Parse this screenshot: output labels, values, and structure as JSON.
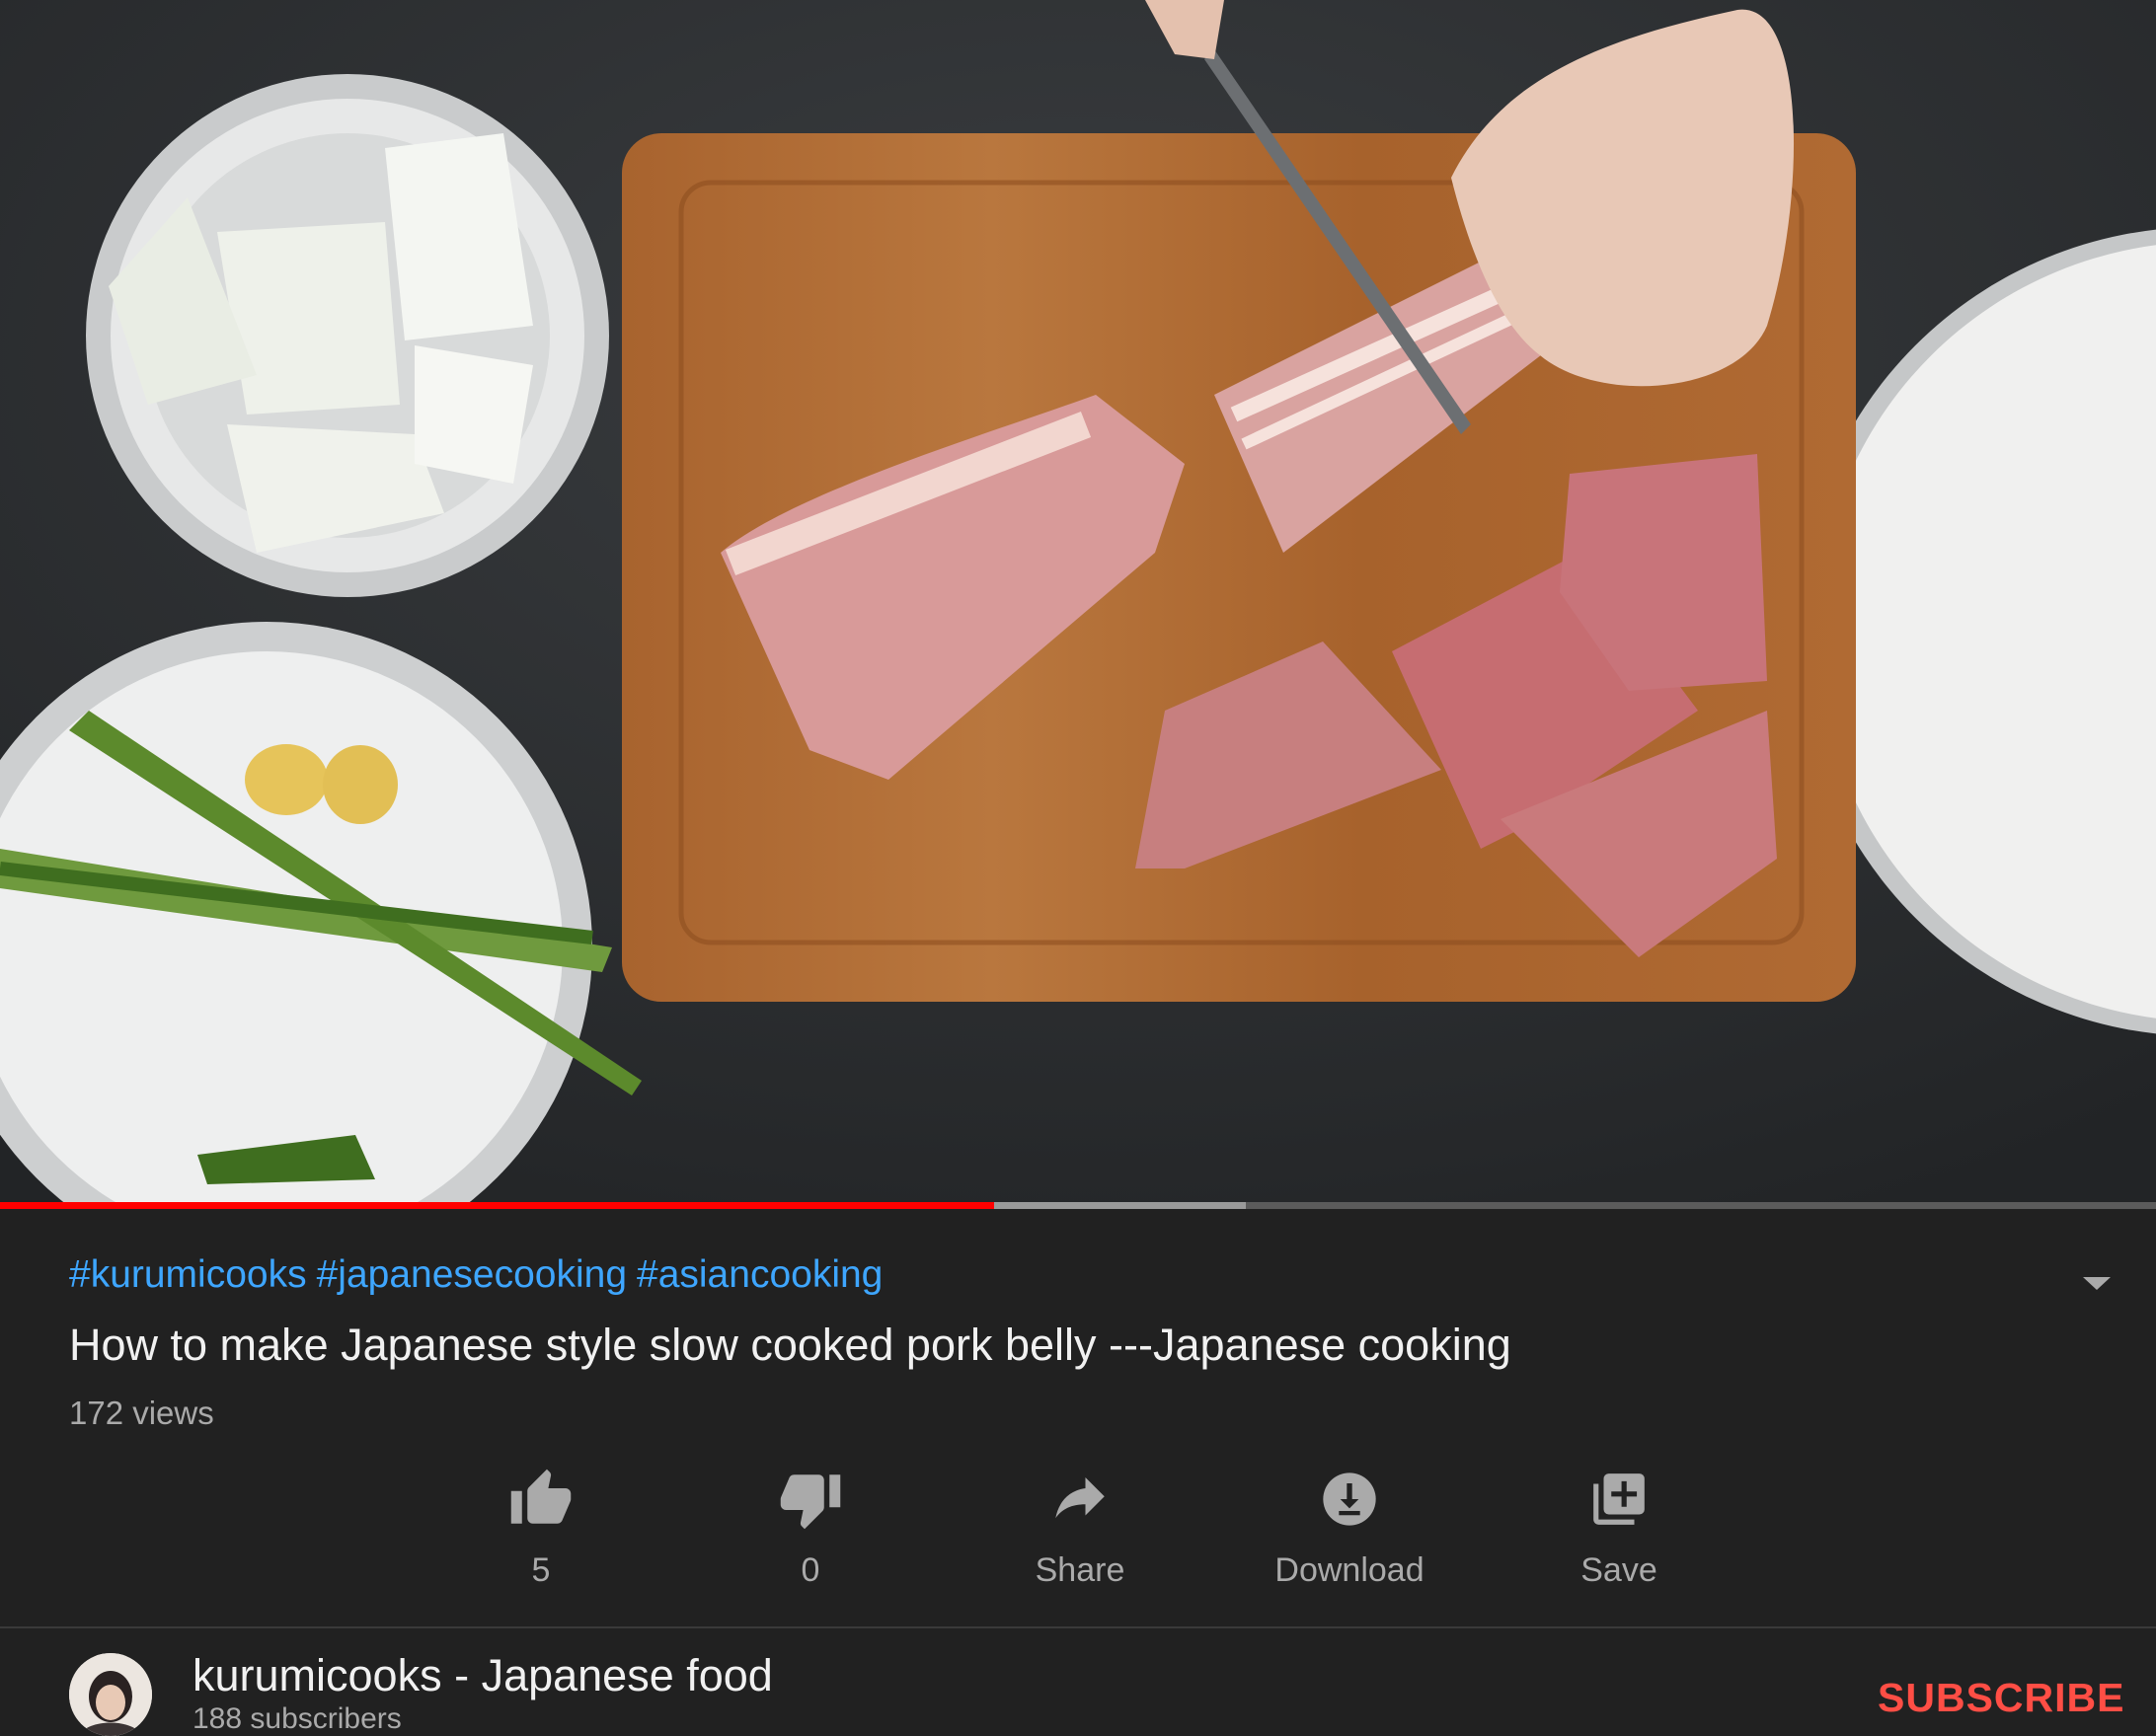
{
  "video": {
    "scene": "overhead-cutting-board-pork-belly",
    "progress_played": 0.461,
    "progress_buffered": 0.578
  },
  "description": {
    "hashtags": [
      "#kurumicooks",
      "#japanesecooking",
      "#asiancooking"
    ],
    "title": "How to make Japanese style slow cooked pork belly ---Japanese cooking",
    "views": "172 views",
    "expand_icon": "chevron-down-icon"
  },
  "actions": [
    {
      "key": "like",
      "label": "5",
      "icon": "thumbs-up-icon"
    },
    {
      "key": "dislike",
      "label": "0",
      "icon": "thumbs-down-icon"
    },
    {
      "key": "share",
      "label": "Share",
      "icon": "share-icon"
    },
    {
      "key": "download",
      "label": "Download",
      "icon": "download-icon"
    },
    {
      "key": "save",
      "label": "Save",
      "icon": "add-to-playlist-icon"
    }
  ],
  "channel": {
    "name": "kurumicooks - Japanese food",
    "subscribers": "188 subscribers",
    "subscribe_label": "SUBSCRIBE"
  },
  "colors": {
    "background": "#212121",
    "hashtag": "#3ea6ff",
    "progress_played": "#ff0000",
    "subscribe": "#ff4e45",
    "icon": "#aaaaaa"
  }
}
